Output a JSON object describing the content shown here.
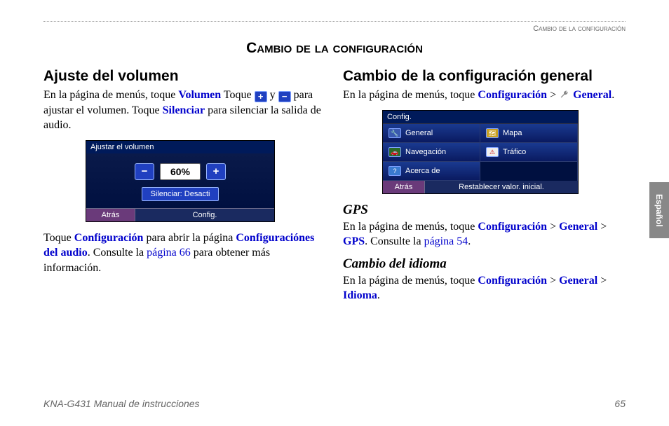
{
  "header": {
    "breadcrumb": "Cambio de la configuración"
  },
  "title": "Cambio de la configuración",
  "language_tab": "Español",
  "footer": {
    "manual": "KNA-G431 Manual de instrucciones",
    "page": "65"
  },
  "left": {
    "h2": "Ajuste del volumen",
    "p1": {
      "t1": "En la página de menús, toque ",
      "kw1": "Volumen",
      "t2": " Toque ",
      "plus": "+",
      "t3": " y ",
      "minus": "−",
      "t4": " para ajustar el volumen. Toque ",
      "kw2": "Silenciar",
      "t5": " para silenciar la salida de audio."
    },
    "device": {
      "title": "Ajustar el volumen",
      "minus": "−",
      "value": "60%",
      "plus": "+",
      "mute": "Silenciar:  Desacti",
      "back": "Atrás",
      "config": "Config."
    },
    "p2": {
      "t1": "Toque ",
      "kw1": "Configuración",
      "t2": " para abrir la página ",
      "kw2": "Configuraciónes del audio",
      "t3": ". Consulte la ",
      "link": "página 66",
      "t4": " para obtener más información."
    }
  },
  "right": {
    "h2": "Cambio de la configuración general",
    "p1": {
      "t1": "En la página de menús, toque ",
      "kw1": "Configuración",
      "sep": " > ",
      "kw2": "General",
      "dot": "."
    },
    "device": {
      "title": "Config.",
      "items": {
        "general": "General",
        "mapa": "Mapa",
        "nav": "Navegación",
        "trafico": "Tráfico",
        "acerca": "Acerca de"
      },
      "back": "Atrás",
      "reset": "Restablecer valor. inicial."
    },
    "gps": {
      "h3": "GPS",
      "t1": "En la página de menús, toque ",
      "kw1": "Configuración",
      "sep1": " > ",
      "kw2": "General",
      "sep2": " > ",
      "kw3": "GPS",
      "t2": ". Consulte la ",
      "link": "página 54",
      "dot": "."
    },
    "idioma": {
      "h3": "Cambio del idioma",
      "t1": "En la página de menús, toque ",
      "kw1": "Configuración",
      "sep1": " > ",
      "kw2": "General",
      "sep2": " > ",
      "kw3": "Idioma",
      "dot": "."
    }
  }
}
